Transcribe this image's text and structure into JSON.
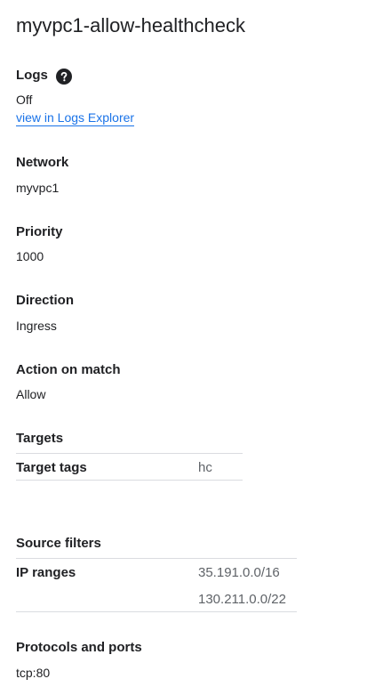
{
  "title": "myvpc1-allow-healthcheck",
  "logs": {
    "label": "Logs",
    "help_icon": "help-circle-icon",
    "value": "Off",
    "link": "view in Logs Explorer",
    "link_color": "#1a73e8"
  },
  "network": {
    "label": "Network",
    "value": "myvpc1"
  },
  "priority": {
    "label": "Priority",
    "value": "1000"
  },
  "direction": {
    "label": "Direction",
    "value": "Ingress"
  },
  "action": {
    "label": "Action on match",
    "value": "Allow"
  },
  "targets": {
    "label": "Targets",
    "rows": [
      {
        "key": "Target tags",
        "value": "hc"
      }
    ]
  },
  "source_filters": {
    "label": "Source filters",
    "rows": [
      {
        "key": "IP ranges",
        "values": [
          "35.191.0.0/16",
          "130.211.0.0/22"
        ]
      }
    ]
  },
  "protocols": {
    "label": "Protocols and ports",
    "value": "tcp:80"
  }
}
